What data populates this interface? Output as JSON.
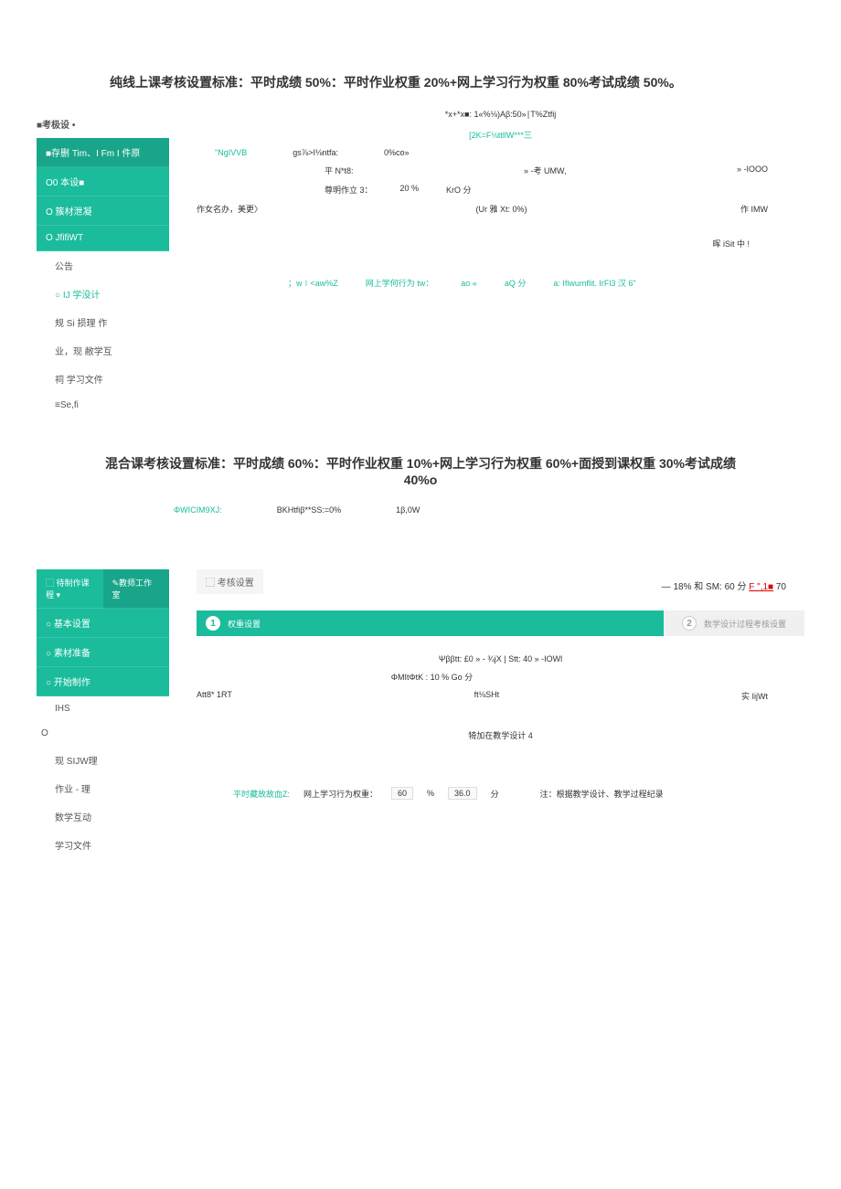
{
  "title1": "纯线上课考核设置标准：平时成绩 50%：平时作业权重 20%+网上学习行为权重 80%考试成绩 50%。",
  "sec1": {
    "header_label": "■考极设 •",
    "top_crumb": "*x+*x■:   1«%⅛)Aβ:50»∣T%Ztfij",
    "nav1": "■存删 Tim、I Fm I 件原",
    "nav2": "O0 本设■",
    "nav3": "O 簇材泄凝",
    "nav4": "O JfifiWT",
    "menu1": "公告",
    "menu2": "○ IJ 学没计",
    "menu3": "规 Si 损理 作",
    "menu4": "业，现 敝学互",
    "menu5": "祠 学习文件",
    "menu6": "≡Se,fi",
    "step1": "[2K=F⅛ttllW***三",
    "c_left": "\"NgIVVB",
    "c_mid1": "gs⅞>I⅛ntfa:",
    "c_mid2": "0%co»",
    "row_a1": "平 N*t8:",
    "row_a2": "» -考 UMW,",
    "row_a3": "» -IOOO",
    "row_b1": "尊明作立 3：",
    "row_b2": "20 %",
    "row_b3": "KrO 分",
    "row_c1": "作女名办，美更〉",
    "row_c2": "(Ur 雅  Xt: 0%)",
    "row_c3": "作 IMW",
    "row_d": "晖 iSit 中 !",
    "foot1": "；w∣<aw%Z",
    "foot2": "网上学何行为 tw：",
    "foot3": "ao «",
    "foot4": "aQ 分",
    "foot5": "a:   Ifiwumflit. IrFl3 汉 6\""
  },
  "title2": "混合课考核设置标准：平时成绩 60%：平时作业权重 10%+网上学习行为权重 60%+面授到课权重 30%考试成绩 40%o",
  "line2": {
    "a": "ΦWICIM9XJ:",
    "b": "BKHtfiβ**SS:=0%",
    "c": "1β,0W"
  },
  "sec2": {
    "nav_top1": "⬚ 待制作课程 ▾",
    "nav_top2": "✎教师工作室",
    "nav1": "○  基本设置",
    "nav2": "○  素材准备",
    "nav3": "○  开始制作",
    "menu1": "IHS",
    "menu_o": "O",
    "menu2": "现 SIJW理",
    "menu3": "作业 - 理",
    "menu4": "数学互动",
    "menu5": "学习文件",
    "header": "⬚ 考核设置",
    "top_right_a": "— 18% 和 SM: 60 分 ",
    "top_right_b": "F \",1■",
    "top_right_c": " 70",
    "step1_label": "权重设置",
    "step2_label": "数学设计过程考核设置",
    "row_a": "Ψββtt: £0 » - ¾jX   |  Stt: 40 » -IOWl",
    "row_b": "ΦMItΦtK : 10 % Go 分",
    "row_c1": "Att8* 1RT",
    "row_c2": "ft⅛SHt",
    "row_c3": "实 IijWt",
    "row_d": "犄加在教学设计 4",
    "foot1": "平时藏故故血Z:",
    "foot2": "网上学习行为权重：",
    "foot3": "60",
    "foot3b": "%",
    "foot4": "36.0",
    "foot4b": "分",
    "foot5": "注：根据教学设计、教学过程纪录"
  }
}
